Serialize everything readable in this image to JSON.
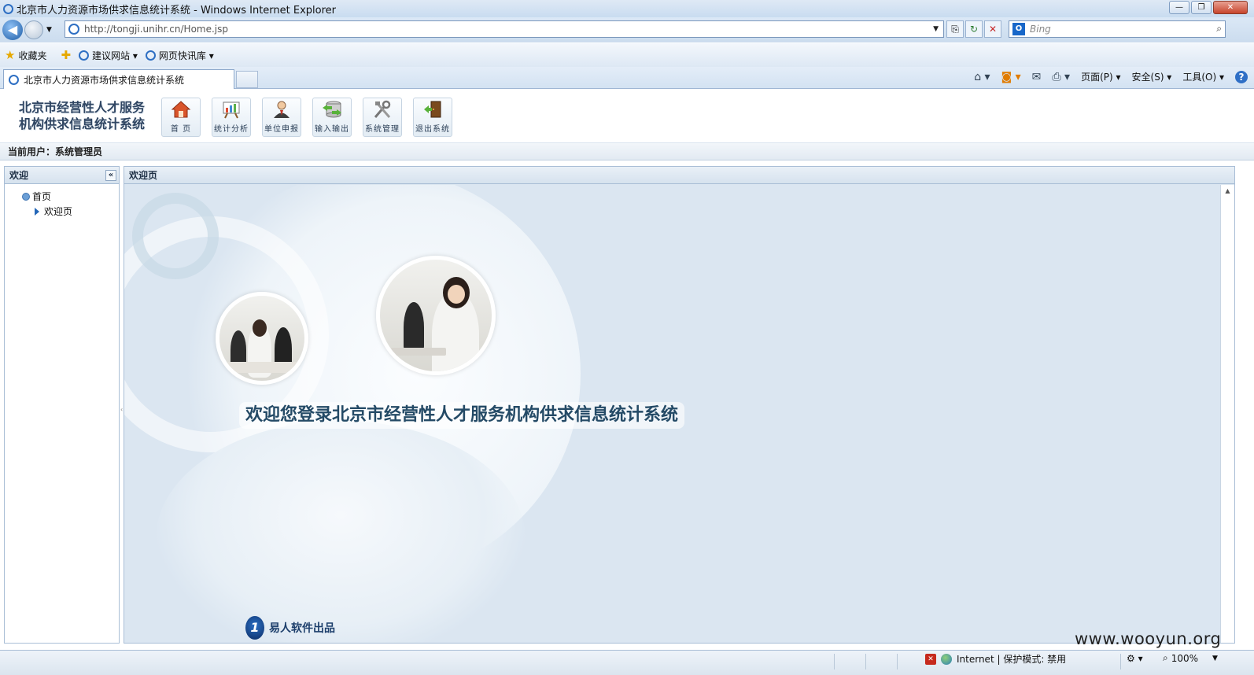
{
  "window": {
    "title": "北京市人力资源市场供求信息统计系统 - Windows Internet Explorer",
    "btn_min": "—",
    "btn_max": "❐",
    "btn_close": "✕"
  },
  "address": {
    "url": "http://tongji.unihr.cn/Home.jsp",
    "search_placeholder": "Bing",
    "search_logo": "O"
  },
  "favorites": {
    "label": "收藏夹",
    "items": [
      "建议网站 ▾",
      "网页快讯库 ▾"
    ]
  },
  "ie_tab": {
    "label": "北京市人力资源市场供求信息统计系统"
  },
  "command_bar": {
    "page": "页面(P) ▾",
    "safety": "安全(S) ▾",
    "tools": "工具(O) ▾",
    "help": "?"
  },
  "app": {
    "logo_line1": "北京市经营性人才服务",
    "logo_line2": "机构供求信息统计系统",
    "toolbar": [
      {
        "label": "首 页",
        "icon": "home-icon"
      },
      {
        "label": "统计分析",
        "icon": "chart-icon"
      },
      {
        "label": "单位申报",
        "icon": "person-icon"
      },
      {
        "label": "输入输出",
        "icon": "database-io-icon"
      },
      {
        "label": "系统管理",
        "icon": "tools-icon"
      },
      {
        "label": "退出系统",
        "icon": "exit-door-icon"
      }
    ],
    "current_user": "当前用户：系统管理员"
  },
  "left_panel": {
    "title": "欢迎",
    "collapse": "«",
    "tree_root": "首页",
    "tree_child": "欢迎页"
  },
  "main_panel": {
    "title": "欢迎页",
    "welcome_text": "欢迎您登录北京市经营性人才服务机构供求信息统计系统",
    "footer_brand": "易人软件出品",
    "footer_mark": "1"
  },
  "status": {
    "zone": "Internet | 保护模式: 禁用",
    "zoom": "100%"
  },
  "watermark": "www.wooyun.org"
}
